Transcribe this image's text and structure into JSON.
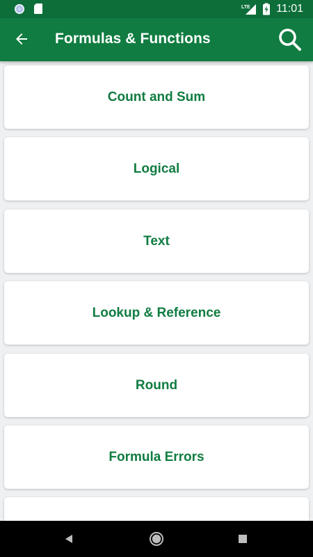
{
  "status_bar": {
    "time": "11:01",
    "network_label": "LTE",
    "icons": [
      "circle-notification-icon",
      "sd-card-icon",
      "signal-icon",
      "battery-charging-icon"
    ]
  },
  "app_bar": {
    "title": "Formulas & Functions",
    "back_icon": "arrow-left-icon",
    "search_icon": "search-icon"
  },
  "categories": [
    {
      "label": "Count and Sum"
    },
    {
      "label": "Logical"
    },
    {
      "label": "Text"
    },
    {
      "label": "Lookup & Reference"
    },
    {
      "label": "Round"
    },
    {
      "label": "Formula Errors"
    },
    {
      "label": ""
    }
  ],
  "nav_bar": {
    "icons": [
      "back-triangle-icon",
      "home-circle-icon",
      "recents-square-icon"
    ]
  },
  "colors": {
    "status_bar": "#0d6e3a",
    "app_bar": "#107c41",
    "accent_text": "#107c41",
    "background": "#eef0f2"
  }
}
